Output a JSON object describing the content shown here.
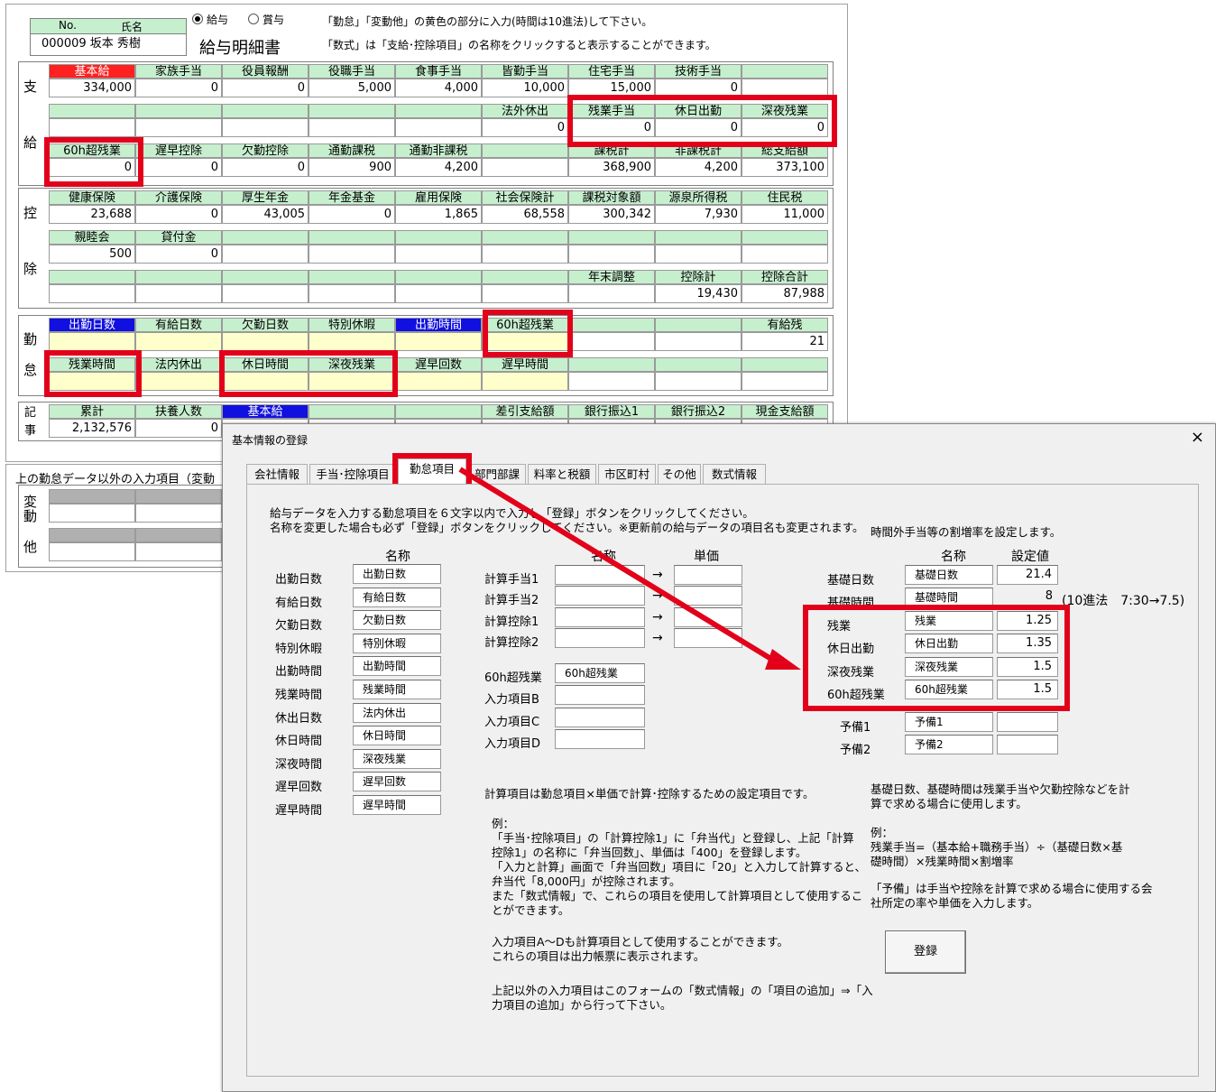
{
  "sheet": {
    "emp_no_label": "No.",
    "emp_name_label": "氏名",
    "emp_value": "000009 坂本 秀樹",
    "radio_salary": "給与",
    "radio_bonus": "賞与",
    "title": "給与明細書",
    "note1": "「勤怠」「変動他」の黄色の部分に入力(時間は10進法)して下さい。",
    "note2": "「数式」は「支給･控除項目」の名称をクリックすると表示することができます。",
    "pay_group_label": [
      "支",
      "給"
    ],
    "deduct_group_label": [
      "控",
      "除"
    ],
    "att_group_label": [
      "勤",
      "怠"
    ],
    "rec_group_label": [
      "記",
      "事"
    ],
    "var_group_label": [
      "変",
      "動",
      "他"
    ],
    "var_title": "上の勤怠データ以外の入力項目（変動",
    "pay_rows": [
      {
        "labels": [
          "基本給",
          "家族手当",
          "役員報酬",
          "役職手当",
          "食事手当",
          "皆勤手当",
          "住宅手当",
          "技術手当",
          ""
        ],
        "values": [
          "334,000",
          "0",
          "0",
          "5,000",
          "4,000",
          "10,000",
          "15,000",
          "0",
          ""
        ]
      },
      {
        "labels": [
          "",
          "",
          "",
          "",
          "",
          "法外休出",
          "残業手当",
          "休日出勤",
          "深夜残業"
        ],
        "values": [
          "",
          "",
          "",
          "",
          "",
          "0",
          "0",
          "0",
          "0"
        ]
      },
      {
        "labels": [
          "60h超残業",
          "遅早控除",
          "欠勤控除",
          "通勤課税",
          "通勤非課税",
          "",
          "課税計",
          "非課税計",
          "総支給額"
        ],
        "values": [
          "0",
          "0",
          "0",
          "900",
          "4,200",
          "",
          "368,900",
          "4,200",
          "373,100"
        ]
      }
    ],
    "deduct_rows": [
      {
        "labels": [
          "健康保険",
          "介護保険",
          "厚生年金",
          "年金基金",
          "雇用保険",
          "社会保険計",
          "課税対象額",
          "源泉所得税",
          "住民税"
        ],
        "values": [
          "23,688",
          "0",
          "43,005",
          "0",
          "1,865",
          "68,558",
          "300,342",
          "7,930",
          "11,000"
        ]
      },
      {
        "labels": [
          "親睦会",
          "貸付金",
          "",
          "",
          "",
          "",
          "",
          "",
          ""
        ],
        "values": [
          "500",
          "0",
          "",
          "",
          "",
          "",
          "",
          "",
          ""
        ]
      },
      {
        "labels": [
          "",
          "",
          "",
          "",
          "",
          "",
          "年末調整",
          "控除計",
          "控除合計"
        ],
        "values": [
          "",
          "",
          "",
          "",
          "",
          "",
          "",
          "19,430",
          "87,988"
        ]
      }
    ],
    "att_rows": [
      {
        "labels": [
          "出勤日数",
          "有給日数",
          "欠勤日数",
          "特別休暇",
          "出勤時間",
          "60h超残業",
          "",
          "",
          "有給残"
        ],
        "values": [
          "",
          "",
          "",
          "",
          "",
          "",
          "",
          "",
          "21"
        ]
      },
      {
        "labels": [
          "残業時間",
          "法内休出",
          "休日時間",
          "深夜残業",
          "遅早回数",
          "遅早時間",
          "",
          "",
          ""
        ],
        "values": [
          "",
          "",
          "",
          "",
          "",
          "",
          "",
          "",
          ""
        ]
      }
    ],
    "rec_row": {
      "labels": [
        "累計",
        "扶養人数",
        "基本給",
        "",
        "",
        "差引支給額",
        "銀行振込1",
        "銀行振込2",
        "現金支給額"
      ],
      "values": [
        "2,132,576",
        "0",
        "",
        "",
        "",
        "",
        "",
        "",
        ""
      ]
    }
  },
  "dialog": {
    "title": "基本情報の登録",
    "close": "×",
    "tabs": [
      "会社情報",
      "手当･控除項目",
      "勤怠項目",
      "部門部課",
      "料率と税額",
      "市区町村",
      "その他",
      "数式情報"
    ],
    "active_tab": 2,
    "intro1": "給与データを入力する勤怠項目を６文字以内で入力し「登録」ボタンをクリックしてください。",
    "intro2": "名称を変更した場合も必ず「登録」ボタンをクリックしてください。※更新前の給与データの項目名も変更されます。",
    "name_header": "名称",
    "att_items": [
      {
        "label": "出勤日数",
        "value": "出勤日数"
      },
      {
        "label": "有給日数",
        "value": "有給日数"
      },
      {
        "label": "欠勤日数",
        "value": "欠勤日数"
      },
      {
        "label": "特別休暇",
        "value": "特別休暇"
      },
      {
        "label": "出勤時間",
        "value": "出勤時間"
      },
      {
        "label": "残業時間",
        "value": "残業時間"
      },
      {
        "label": "休出日数",
        "value": "法内休出"
      },
      {
        "label": "休日時間",
        "value": "休日時間"
      },
      {
        "label": "深夜時間",
        "value": "深夜残業"
      },
      {
        "label": "遅早回数",
        "value": "遅早回数"
      },
      {
        "label": "遅早時間",
        "value": "遅早時間"
      }
    ],
    "calc_name_header": "名称",
    "calc_price_header": "単価",
    "calc_items": [
      {
        "label": "計算手当1",
        "name": "",
        "arrow": "→",
        "price": ""
      },
      {
        "label": "計算手当2",
        "name": "",
        "arrow": "→",
        "price": ""
      },
      {
        "label": "計算控除1",
        "name": "",
        "arrow": "→",
        "price": ""
      },
      {
        "label": "計算控除2",
        "name": "",
        "arrow": "→",
        "price": ""
      }
    ],
    "input_items": [
      {
        "label": "60h超残業",
        "value": "60h超残業"
      },
      {
        "label": "入力項目B",
        "value": ""
      },
      {
        "label": "入力項目C",
        "value": ""
      },
      {
        "label": "入力項目D",
        "value": ""
      }
    ],
    "rate_intro": "時間外手当等の割増率を設定します。",
    "rate_name_header": "名称",
    "rate_value_header": "設定値",
    "rate_items": [
      {
        "label": "基礎日数",
        "name": "基礎日数",
        "value": "21.4"
      },
      {
        "label": "基礎時間",
        "name": "基礎時間",
        "value": "8"
      },
      {
        "label": "残業",
        "name": "残業",
        "value": "1.25"
      },
      {
        "label": "休日出勤",
        "name": "休日出勤",
        "value": "1.35"
      },
      {
        "label": "深夜残業",
        "name": "深夜残業",
        "value": "1.5"
      },
      {
        "label": "60h超残業",
        "name": "60h超残業",
        "value": "1.5"
      },
      {
        "label": "予備1",
        "name": "予備1",
        "value": ""
      },
      {
        "label": "予備2",
        "name": "予備2",
        "value": ""
      }
    ],
    "base_time_note": "(10進法　7:30→7.5)",
    "calc_note": "計算項目は勤怠項目×単価で計算･控除するための設定項目です。",
    "example_block": "例：\n「手当･控除項目」の「計算控除1」に「弁当代」と登録し、上記「計算\n控除1」の名称に「弁当回数」、単価は「400」を登録します。\n「入力と計算」画面で「弁当回数」項目に「20」と入力して計算すると、\n弁当代「8,000円」が控除されます。\nまた「数式情報」で、これらの項目を使用して計算項目として使用するこ\nとができます。",
    "input_note": "入力項目A～Dも計算項目として使用することができます。\nこれらの項目は出力帳票に表示されます。",
    "other_note": "上記以外の入力項目はこのフォームの「数式情報」の「項目の追加」⇒「入\n力項目の追加」から行って下さい。",
    "base_note": "基礎日数、基礎時間は残業手当や欠勤控除などを計\n算で求める場合に使用します。",
    "formula_example": "例：\n残業手当=（基本給+職務手当）÷（基礎日数×基\n礎時間）×残業時間×割増率",
    "reserve_note": "「予備」は手当や控除を計算で求める場合に使用する会\n社所定の率や単価を入力します。",
    "register_button": "登録"
  },
  "highlight_color": "#e2001a"
}
